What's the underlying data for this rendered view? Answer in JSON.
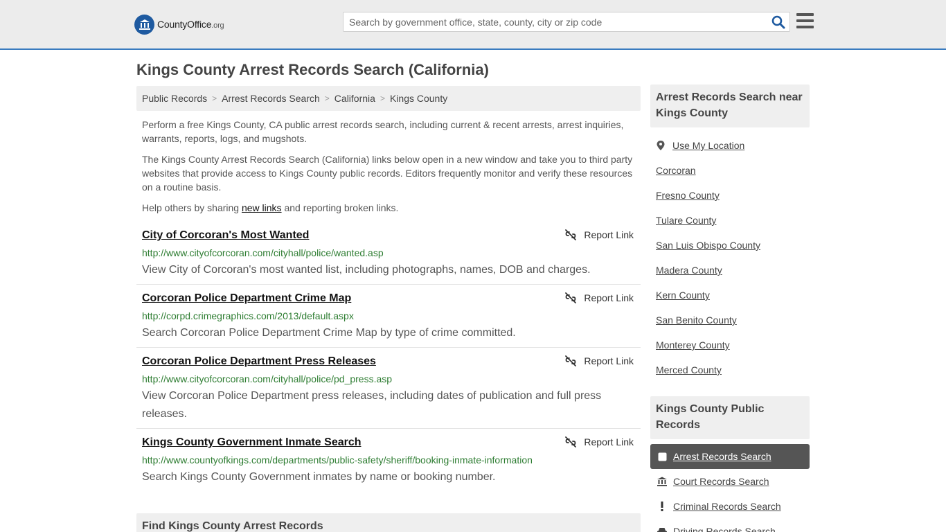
{
  "header": {
    "logo_county": "County",
    "logo_office": "Office",
    "logo_org": ".org",
    "search_placeholder": "Search by government office, state, county, city or zip code"
  },
  "page_title": "Kings County Arrest Records Search (California)",
  "breadcrumb": [
    "Public Records",
    "Arrest Records Search",
    "California",
    "Kings County"
  ],
  "intro": {
    "p1": "Perform a free Kings County, CA public arrest records search, including current & recent arrests, arrest inquiries, warrants, reports, logs, and mugshots.",
    "p2": "The Kings County Arrest Records Search (California) links below open in a new window and take you to third party websites that provide access to Kings County public records. Editors frequently monitor and verify these resources on a routine basis.",
    "p3_before": "Help others by sharing ",
    "p3_link": "new links",
    "p3_after": " and reporting broken links."
  },
  "report_label": "Report Link",
  "results": [
    {
      "title": "City of Corcoran's Most Wanted",
      "url": "http://www.cityofcorcoran.com/cityhall/police/wanted.asp",
      "desc": "View City of Corcoran's most wanted list, including photographs, names, DOB and charges."
    },
    {
      "title": "Corcoran Police Department Crime Map",
      "url": "http://corpd.crimegraphics.com/2013/default.aspx",
      "desc": "Search Corcoran Police Department Crime Map by type of crime committed."
    },
    {
      "title": "Corcoran Police Department Press Releases",
      "url": "http://www.cityofcorcoran.com/cityhall/police/pd_press.asp",
      "desc": "View Corcoran Police Department press releases, including dates of publication and full press releases."
    },
    {
      "title": "Kings County Government Inmate Search",
      "url": "http://www.countyofkings.com/departments/public-safety/sheriff/booking-inmate-information",
      "desc": "Search Kings County Government inmates by name or booking number."
    }
  ],
  "find_heading": "Find Kings County Arrest Records",
  "sidebar": {
    "near_heading": "Arrest Records Search near Kings County",
    "use_location": "Use My Location",
    "near_links": [
      "Corcoran",
      "Fresno County",
      "Tulare County",
      "San Luis Obispo County",
      "Madera County",
      "Kern County",
      "San Benito County",
      "Monterey County",
      "Merced County"
    ],
    "records_heading": "Kings County Public Records",
    "records_items": [
      {
        "label": "Arrest Records Search",
        "icon": "square-icon",
        "active": true
      },
      {
        "label": "Court Records Search",
        "icon": "courthouse-icon",
        "active": false
      },
      {
        "label": "Criminal Records Search",
        "icon": "exclamation-icon",
        "active": false
      },
      {
        "label": "Driving Records Search",
        "icon": "car-icon",
        "active": false
      }
    ]
  },
  "colors": {
    "accent": "#3a7bbf",
    "link_green": "#2e7d32",
    "active_bg": "#555555"
  }
}
